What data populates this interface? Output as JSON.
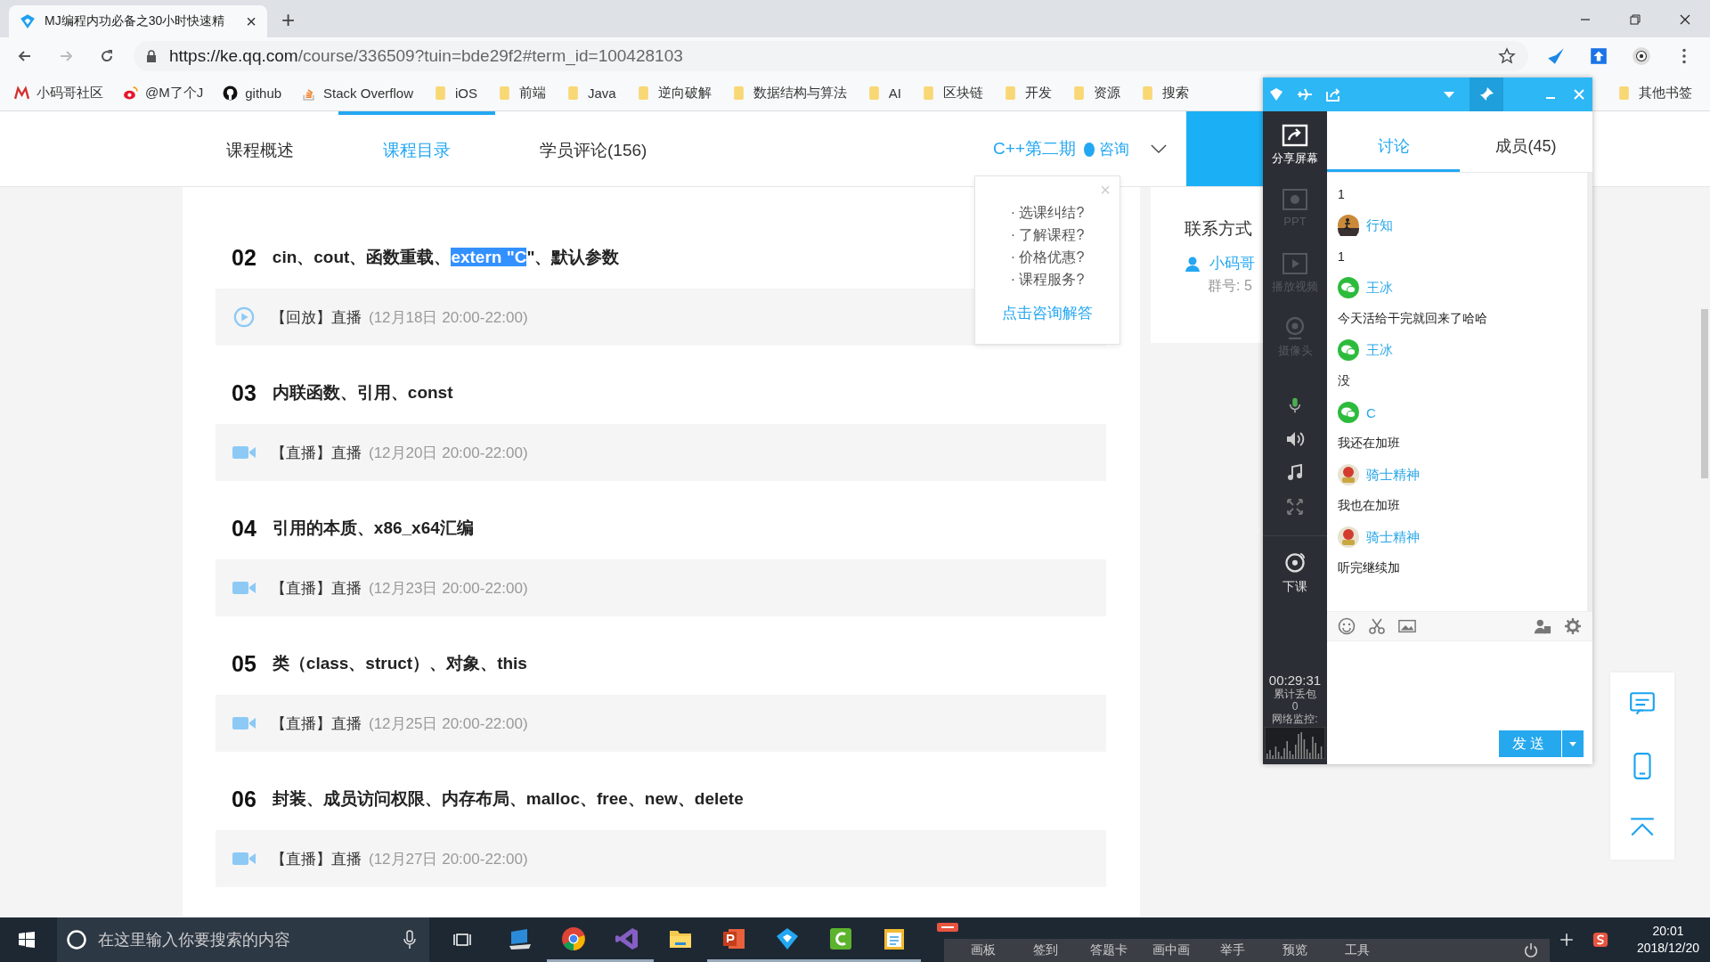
{
  "browser": {
    "tab_title": "MJ编程内功必备之30小时快速精",
    "tab_close": "×",
    "new_tab": "+",
    "url_host": "https://ke.qq.com",
    "url_path": "/course/336509?tuin=bde29f2#term_id=100428103"
  },
  "bookmarks": [
    {
      "label": "小码哥社区",
      "kind": "m"
    },
    {
      "label": "@M了个J",
      "kind": "weibo"
    },
    {
      "label": "github",
      "kind": "github"
    },
    {
      "label": "Stack Overflow",
      "kind": "stack"
    },
    {
      "label": "iOS",
      "kind": "folder"
    },
    {
      "label": "前端",
      "kind": "folder"
    },
    {
      "label": "Java",
      "kind": "folder"
    },
    {
      "label": "逆向破解",
      "kind": "folder"
    },
    {
      "label": "数据结构与算法",
      "kind": "folder"
    },
    {
      "label": "AI",
      "kind": "folder"
    },
    {
      "label": "区块链",
      "kind": "folder"
    },
    {
      "label": "开发",
      "kind": "folder"
    },
    {
      "label": "资源",
      "kind": "folder"
    },
    {
      "label": "搜索",
      "kind": "folder"
    }
  ],
  "other_bookmarks": "其他书签",
  "course_nav": {
    "tabs": [
      {
        "label": "课程概述",
        "selected": false
      },
      {
        "label": "课程目录",
        "selected": true
      },
      {
        "label": "学员评论(156)",
        "selected": false
      }
    ],
    "term": "C++第二期",
    "consult": "咨询"
  },
  "lessons": [
    {
      "number": "02",
      "title": [
        {
          "text": "cin、cout、函数重载、",
          "selected": false
        },
        {
          "text": "extern \"C",
          "selected": true
        },
        {
          "text": "\"、默认参数",
          "selected": false
        }
      ],
      "kind": "replay",
      "tag": "【回放】直播",
      "time": "(12月18日 20:00-22:00)"
    },
    {
      "number": "03",
      "title": [
        {
          "text": "内联函数、引用、const",
          "selected": false
        }
      ],
      "kind": "live",
      "tag": "【直播】直播",
      "time": "(12月20日 20:00-22:00)"
    },
    {
      "number": "04",
      "title": [
        {
          "text": "引用的本质、x86_x64汇编",
          "selected": false
        }
      ],
      "kind": "live",
      "tag": "【直播】直播",
      "time": "(12月23日 20:00-22:00)"
    },
    {
      "number": "05",
      "title": [
        {
          "text": "类（class、struct）、对象、this",
          "selected": false
        }
      ],
      "kind": "live",
      "tag": "【直播】直播",
      "time": "(12月25日 20:00-22:00)"
    },
    {
      "number": "06",
      "title": [
        {
          "text": "封装、成员访问权限、内存布局、malloc、free、new、delete",
          "selected": false
        }
      ],
      "kind": "live",
      "tag": "【直播】直播",
      "time": "(12月27日 20:00-22:00)"
    }
  ],
  "consult_popup": {
    "close": "×",
    "items": [
      "· 选课纠结?",
      "· 了解课程?",
      "· 价格优惠?",
      "· 课程服务?"
    ],
    "link": "点击咨询解答"
  },
  "sidebar": {
    "title": "联系方式",
    "contact": "小码哥",
    "group": "群号: 5"
  },
  "panel": {
    "tools": [
      {
        "label": "分享屏幕",
        "kind": "share",
        "disabled": false
      },
      {
        "label": "PPT",
        "kind": "ppt",
        "disabled": true
      },
      {
        "label": "播放视频",
        "kind": "video",
        "disabled": true
      },
      {
        "label": "摄像头",
        "kind": "camera",
        "disabled": true
      }
    ],
    "audio_controls": [
      {
        "kind": "mic"
      },
      {
        "kind": "speaker"
      },
      {
        "kind": "music"
      },
      {
        "kind": "fullscreen"
      }
    ],
    "end_class": "下课",
    "timer": "00:29:31",
    "loss_label": "累计丢包",
    "loss_value": "0",
    "monitor_label": "网络监控:",
    "tabs": [
      {
        "label": "讨论",
        "selected": true
      },
      {
        "label": "成员(45)",
        "selected": false
      }
    ],
    "messages": [
      {
        "text": "1"
      },
      {
        "name": "行知",
        "kind": "photo",
        "text": "1"
      },
      {
        "name": "王冰",
        "kind": "wechat",
        "text": "今天活给干完就回来了哈哈"
      },
      {
        "name": "王冰",
        "kind": "wechat",
        "text": "没"
      },
      {
        "name": "C",
        "kind": "wechat",
        "text": "我还在加班"
      },
      {
        "name": "骑士精神",
        "kind": "cartoon",
        "text": "我也在加班"
      },
      {
        "name": "骑士精神",
        "kind": "cartoon",
        "text": "听完继续加"
      }
    ],
    "send": "发送"
  },
  "taskbar": {
    "search_placeholder": "在这里输入你要搜索的内容",
    "apps": [
      {
        "kind": "pc",
        "active": false
      },
      {
        "kind": "chrome",
        "active": true
      },
      {
        "kind": "vs",
        "active": true
      },
      {
        "kind": "folder",
        "active": false
      },
      {
        "kind": "ppt",
        "active": true
      },
      {
        "kind": "tencent",
        "active": true
      },
      {
        "kind": "camtasia",
        "active": true
      },
      {
        "kind": "notes",
        "active": true
      },
      {
        "kind": "slides"
      }
    ],
    "class_tools": [
      "画板",
      "签到",
      "答题卡",
      "画中画",
      "举手",
      "预览",
      "工具"
    ],
    "time": "20:01",
    "date": "2018/12/20"
  }
}
